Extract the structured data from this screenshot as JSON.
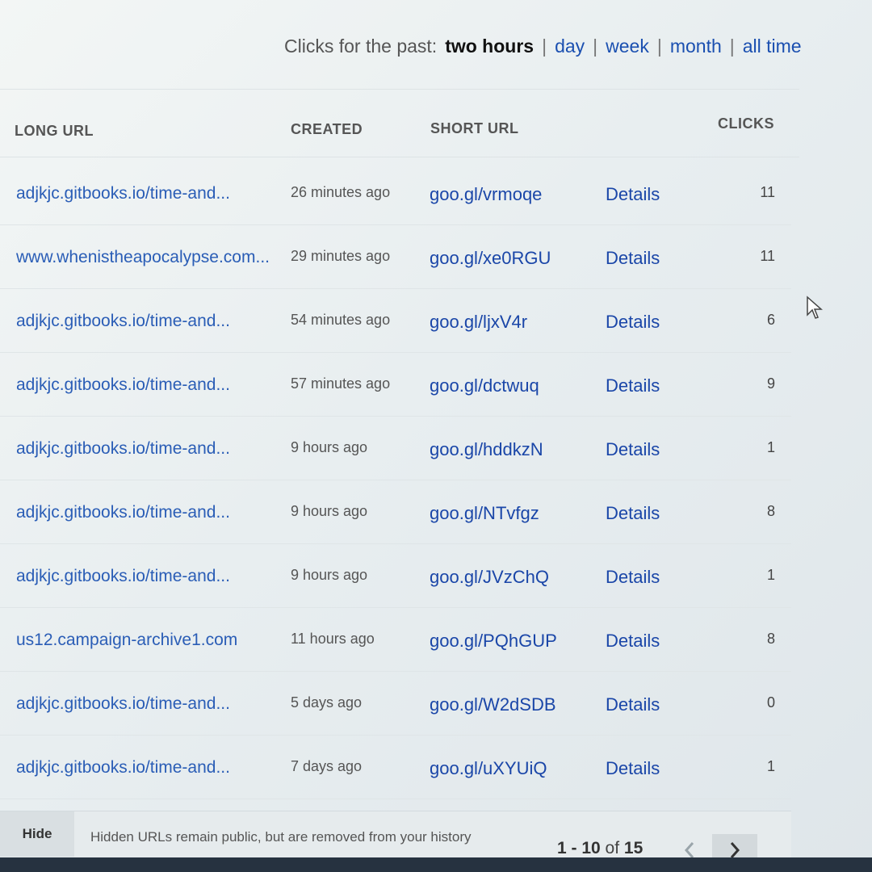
{
  "filter": {
    "prefix": "Clicks for the past:",
    "current": "two hours",
    "options": [
      "day",
      "week",
      "month",
      "all time"
    ],
    "separator": "|"
  },
  "table": {
    "headers": {
      "long_url": "LONG URL",
      "created": "CREATED",
      "short_url": "SHORT URL",
      "clicks": "CLICKS"
    },
    "rows": [
      {
        "long_url": "adjkjc.gitbooks.io/time-and...",
        "created": "26 minutes ago",
        "short_url": "goo.gl/vrmoqe",
        "details": "Details",
        "clicks": "11"
      },
      {
        "long_url": "www.whenistheapocalypse.com...",
        "created": "29 minutes ago",
        "short_url": "goo.gl/xe0RGU",
        "details": "Details",
        "clicks": "11"
      },
      {
        "long_url": "adjkjc.gitbooks.io/time-and...",
        "created": "54 minutes ago",
        "short_url": "goo.gl/ljxV4r",
        "details": "Details",
        "clicks": "6"
      },
      {
        "long_url": "adjkjc.gitbooks.io/time-and...",
        "created": "57 minutes ago",
        "short_url": "goo.gl/dctwuq",
        "details": "Details",
        "clicks": "9"
      },
      {
        "long_url": "adjkjc.gitbooks.io/time-and...",
        "created": "9 hours ago",
        "short_url": "goo.gl/hddkzN",
        "details": "Details",
        "clicks": "1"
      },
      {
        "long_url": "adjkjc.gitbooks.io/time-and...",
        "created": "9 hours ago",
        "short_url": "goo.gl/NTvfgz",
        "details": "Details",
        "clicks": "8"
      },
      {
        "long_url": "adjkjc.gitbooks.io/time-and...",
        "created": "9 hours ago",
        "short_url": "goo.gl/JVzChQ",
        "details": "Details",
        "clicks": "1"
      },
      {
        "long_url": "us12.campaign-archive1.com",
        "created": "11 hours ago",
        "short_url": "goo.gl/PQhGUP",
        "details": "Details",
        "clicks": "8"
      },
      {
        "long_url": "adjkjc.gitbooks.io/time-and...",
        "created": "5 days ago",
        "short_url": "goo.gl/W2dSDB",
        "details": "Details",
        "clicks": "0"
      },
      {
        "long_url": "adjkjc.gitbooks.io/time-and...",
        "created": "7 days ago",
        "short_url": "goo.gl/uXYUiQ",
        "details": "Details",
        "clicks": "1"
      }
    ]
  },
  "footer": {
    "hide_label": "Hide",
    "note": "Hidden URLs remain public, but are removed from your history",
    "range": "1 - 10",
    "of_label": "of",
    "total": "15"
  },
  "icons": {
    "prev": "chevron-left-icon",
    "next": "chevron-right-icon",
    "cursor": "mouse-pointer-icon"
  },
  "colors": {
    "link": "#1a46a8",
    "long_url": "#2a5db6",
    "header_text": "#555555"
  }
}
